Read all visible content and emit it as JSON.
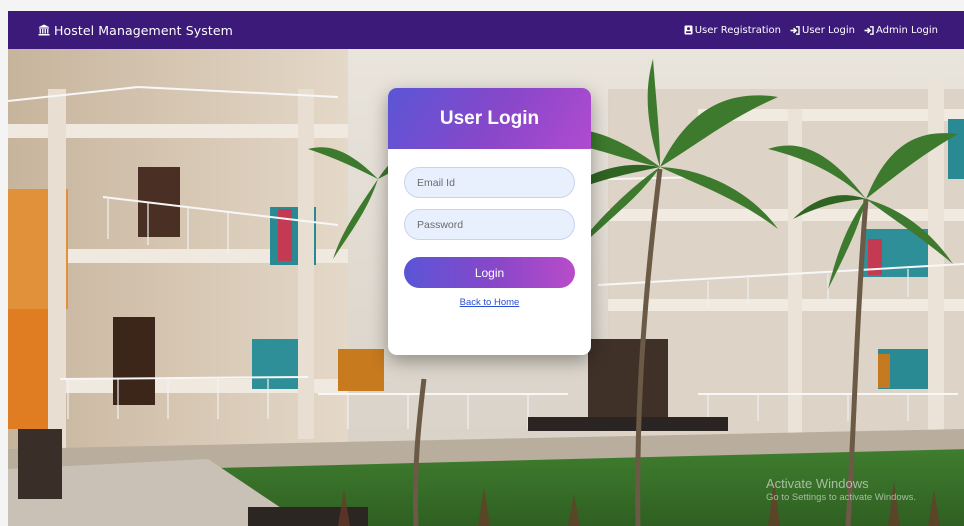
{
  "navbar": {
    "brand_icon": "bank-building-icon",
    "brand": "Hostel Management System",
    "links": [
      {
        "icon": "id-card-icon",
        "label": "User Registration"
      },
      {
        "icon": "sign-in-icon",
        "label": "User Login"
      },
      {
        "icon": "sign-in-icon",
        "label": "Admin Login"
      }
    ],
    "color": "#3b1a7a"
  },
  "login": {
    "title": "User Login",
    "email_placeholder": "Email Id",
    "password_placeholder": "Password",
    "button": "Login",
    "back_link": "Back to Home",
    "gradient_start": "#5a55d6",
    "gradient_end": "#b84cc9"
  },
  "watermark": {
    "title": "Activate Windows",
    "subtitle": "Go to Settings to activate Windows."
  }
}
